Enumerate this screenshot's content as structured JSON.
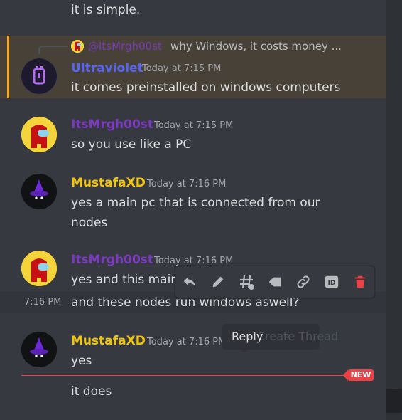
{
  "colors": {
    "ultraviolet": "#5865f2",
    "itsmrgh": "#7c3bbf",
    "mustafa": "#f1c40f",
    "mention_bar": "#faa81a",
    "new": "#ed4245",
    "delete": "#ed4245"
  },
  "messages": {
    "top_text": "it is simple.",
    "reply": {
      "mention": "@ItsMrgh00st",
      "text": "why Windows, it costs money ..."
    },
    "m1": {
      "author": "Ultraviolet",
      "time": "Today at 7:15 PM",
      "text": "it comes preinstalled on windows computers"
    },
    "m2": {
      "author": "ItsMrgh00st",
      "time": "Today at 7:15 PM",
      "text": "so you use like a PC"
    },
    "m3": {
      "author": "MustafaXD",
      "time": "Today at 7:16 PM",
      "line1": "yes a main pc that is connected from our",
      "line2": "nodes"
    },
    "m4": {
      "author": "ItsMrgh00st",
      "time": "Today at 7:16 PM",
      "text": "yes and this main"
    },
    "m4_followup": {
      "hover_time": "7:16 PM",
      "text": "and these nodes run windows aswell?"
    },
    "m5": {
      "author": "MustafaXD",
      "time": "Today at 7:16 PM",
      "text": "yes"
    },
    "last": {
      "text": "it does"
    }
  },
  "toolbar_icons": [
    "reply-icon",
    "edit-icon",
    "create-thread-icon",
    "mark-unread-icon",
    "copy-link-icon",
    "copy-id-icon",
    "delete-icon"
  ],
  "tooltip": {
    "label": "Reply",
    "faded_label": "Create Thread"
  },
  "new_divider": {
    "badge": "NEW"
  }
}
